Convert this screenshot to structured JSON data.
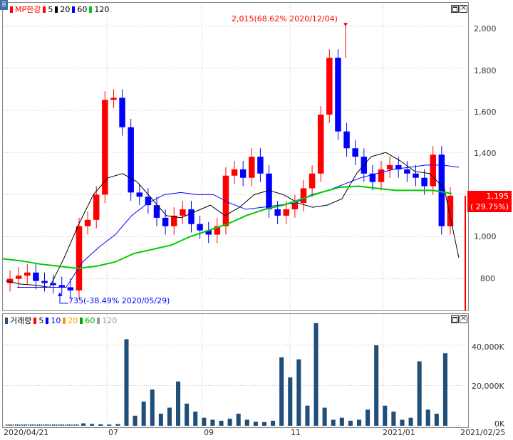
{
  "chart_data": [
    {
      "type": "candlestick",
      "legend": {
        "icon": "corner-tag-icon",
        "corner_label": "호",
        "title": "MP한강",
        "items": [
          {
            "label": "5",
            "color": "#ff0000"
          },
          {
            "label": "20",
            "color": "#000000"
          },
          {
            "label": "60",
            "color": "#0000ff"
          },
          {
            "label": "120",
            "color": "#00cc00"
          }
        ]
      },
      "y_ticks": [
        "2,000",
        "1,800",
        "1,600",
        "1,400",
        "1,200",
        "1,000",
        "800"
      ],
      "y_tick_values": [
        2000,
        1800,
        1600,
        1400,
        1200,
        1000,
        800
      ],
      "ylim": [
        650,
        2060
      ],
      "annotations": {
        "high": "2,015(68.62% 2020/12/04)",
        "low": "735(-38.49% 2020/05/29)"
      },
      "current_price": {
        "value": "1,195",
        "change": "( 29.75%)"
      },
      "x_ticks": [
        "2020/04/21",
        "07",
        "09",
        "11",
        "2021/01",
        "2021/02/25"
      ],
      "colors": {
        "up": "#ff0000",
        "down": "#0000ff",
        "ma5": "#ff0000",
        "ma20": "#000000",
        "ma60": "#0000ff",
        "ma120": "#00cc00"
      },
      "series": [
        {
          "name": "5",
          "values": []
        },
        {
          "name": "20",
          "values": [
            790,
            775,
            770,
            760,
            900,
            1060,
            1200,
            1280,
            1300,
            1260,
            1180,
            1100,
            1090,
            1120,
            1150,
            1100,
            1140,
            1200,
            1220,
            1200,
            1160,
            1140,
            1150,
            1180,
            1300,
            1380,
            1400,
            1360,
            1310,
            1300,
            1230,
            900
          ]
        },
        {
          "name": "60",
          "values": [
            760,
            760,
            760,
            760,
            880,
            950,
            1010,
            1100,
            1160,
            1200,
            1210,
            1200,
            1200,
            1160,
            1130,
            1140,
            1150,
            1160,
            1200,
            1220,
            1250,
            1280,
            1300,
            1320,
            1330,
            1340,
            1340,
            1330
          ]
        },
        {
          "name": "120",
          "values": [
            895,
            885,
            870,
            860,
            850,
            860,
            880,
            920,
            940,
            960,
            1000,
            1030,
            1060,
            1100,
            1130,
            1150,
            1180,
            1210,
            1235,
            1240,
            1230,
            1220,
            1220,
            1220,
            1205
          ]
        }
      ],
      "price_closes": [
        800,
        815,
        830,
        790,
        780,
        770,
        760,
        745,
        1050,
        1080,
        1200,
        1650,
        1660,
        1520,
        1210,
        1190,
        1150,
        1090,
        1050,
        1100,
        1130,
        1060,
        1030,
        1010,
        1050,
        1290,
        1320,
        1280,
        1380,
        1300,
        1130,
        1100,
        1130,
        1160,
        1230,
        1300,
        1580,
        1850,
        1500,
        1420,
        1380,
        1300,
        1260,
        1320,
        1340,
        1320,
        1300,
        1280,
        1240,
        1390,
        1050,
        1195
      ]
    },
    {
      "type": "bar",
      "legend": {
        "title": "거래량",
        "items": [
          {
            "label": "5",
            "color": "#ff0000"
          },
          {
            "label": "10",
            "color": "#0000ff"
          },
          {
            "label": "20",
            "color": "#ff9900"
          },
          {
            "label": "60",
            "color": "#00aa00"
          },
          {
            "label": "120",
            "color": "#999999"
          }
        ]
      },
      "y_ticks": [
        "40,000K",
        "20,000K",
        "0K"
      ],
      "y_tick_values": [
        40000,
        20000,
        0
      ],
      "ylim": [
        0,
        52000
      ],
      "bar_color": "#1f4e79",
      "values": [
        1200,
        900,
        700,
        600,
        800,
        43000,
        5000,
        12000,
        18000,
        6000,
        9000,
        22000,
        11000,
        7000,
        4000,
        3000,
        2500,
        3500,
        6000,
        3000,
        2000,
        1800,
        2500,
        34000,
        24000,
        33000,
        10000,
        51000,
        9000,
        3000,
        4000,
        2500,
        3000,
        8000,
        40000,
        10000,
        7000,
        3000,
        4000,
        32000,
        8000,
        6000,
        36000
      ]
    }
  ]
}
